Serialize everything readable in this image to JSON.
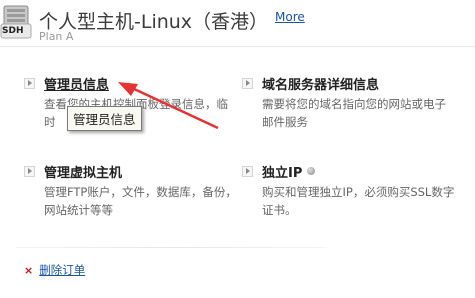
{
  "header": {
    "logo_text": "SDH",
    "title": "个人型主机-Linux（香港）",
    "more_link": "More",
    "plan": "Plan A"
  },
  "items": [
    {
      "title": "管理员信息",
      "desc": "查看您的主机控制面板登录信息，临时"
    },
    {
      "title": "域名服务器详细信息",
      "desc": "需要将您的域名指向您的网站或电子邮件服务"
    },
    {
      "title": "管理虚拟主机",
      "desc": "管理FTP账户，文件，数据库，备份，网站统计等等"
    },
    {
      "title": "独立IP",
      "desc": "购买和管理独立IP，必须购买SSL数字证书。"
    }
  ],
  "tooltip": "管理员信息",
  "footer": {
    "cancel_icon": "x-icon",
    "cancel_label": "删除订单"
  },
  "colors": {
    "link": "#1a55a6",
    "arrow": "#e53232",
    "cancel_x": "#d01515"
  }
}
